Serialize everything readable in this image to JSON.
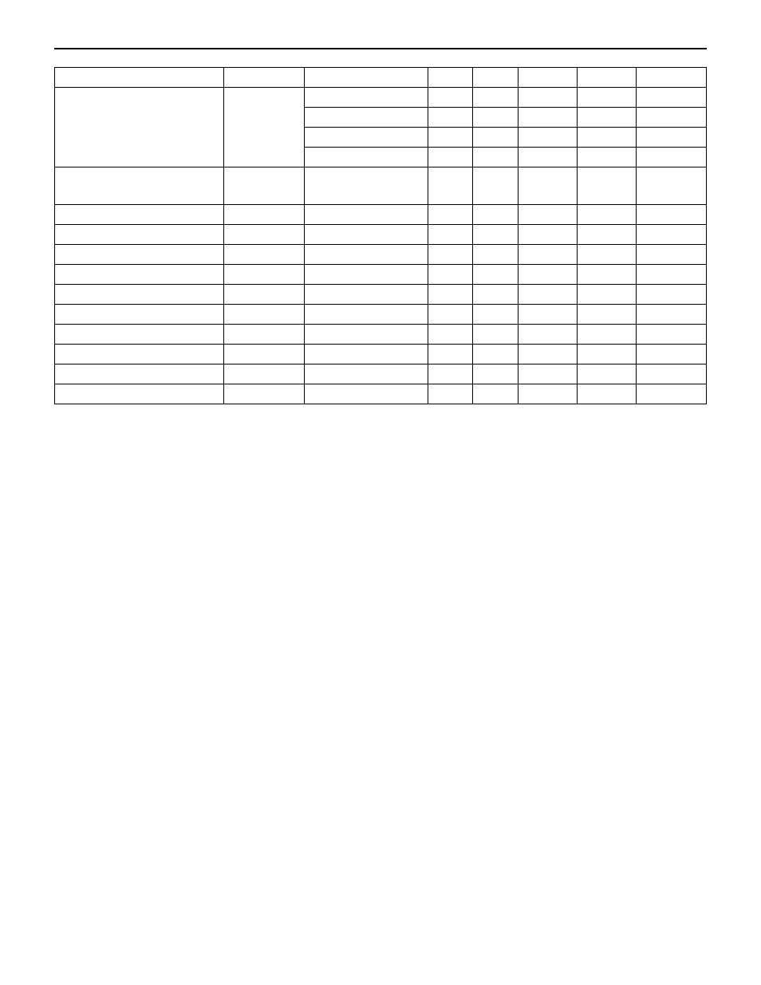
{
  "chart_data": {
    "type": "table",
    "title": "",
    "columns": [
      "",
      "",
      "",
      "",
      "",
      "",
      "",
      ""
    ],
    "rows": [
      [
        "",
        "",
        "",
        "",
        "",
        "",
        "",
        ""
      ],
      [
        "",
        "",
        "",
        "",
        "",
        "",
        "",
        ""
      ],
      [
        "",
        "",
        "",
        "",
        "",
        "",
        "",
        ""
      ],
      [
        "",
        "",
        "",
        "",
        "",
        "",
        "",
        ""
      ],
      [
        "",
        "",
        "",
        "",
        "",
        "",
        "",
        ""
      ],
      [
        "",
        "",
        "",
        "",
        "",
        "",
        "",
        ""
      ],
      [
        "",
        "",
        "",
        "",
        "",
        "",
        "",
        ""
      ],
      [
        "",
        "",
        "",
        "",
        "",
        "",
        "",
        ""
      ],
      [
        "",
        "",
        "",
        "",
        "",
        "",
        "",
        ""
      ],
      [
        "",
        "",
        "",
        "",
        "",
        "",
        "",
        ""
      ],
      [
        "",
        "",
        "",
        "",
        "",
        "",
        "",
        ""
      ],
      [
        "",
        "",
        "",
        "",
        "",
        "",
        "",
        ""
      ],
      [
        "",
        "",
        "",
        "",
        "",
        "",
        "",
        ""
      ],
      [
        "",
        "",
        "",
        "",
        "",
        "",
        "",
        ""
      ],
      [
        "",
        "",
        "",
        "",
        "",
        "",
        "",
        ""
      ],
      [
        "",
        "",
        "",
        "",
        "",
        "",
        "",
        ""
      ]
    ]
  }
}
